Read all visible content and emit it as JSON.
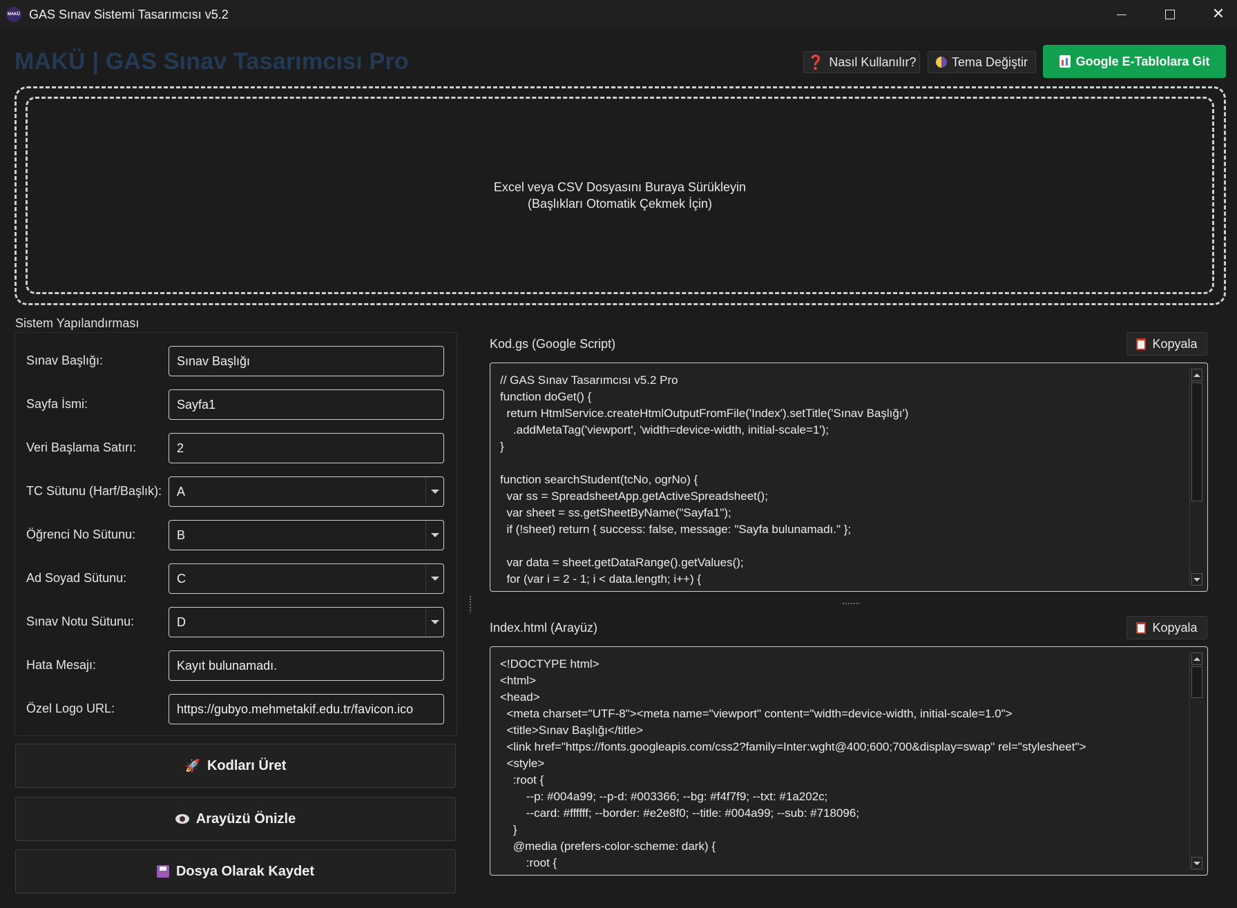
{
  "window": {
    "title": "GAS Sınav Sistemi Tasarımcısı v5.2",
    "icon_text": "MAKÜ",
    "min_icon": "minimize-icon",
    "max_icon": "maximize-icon",
    "close_icon": "close-icon",
    "close_glyph": "✕"
  },
  "header": {
    "brand": "MAKÜ | GAS Sınav Tasarımcısı Pro",
    "help_icon": "❓",
    "help_label": "Nasıl Kullanılır?",
    "theme_label": "Tema Değiştir",
    "sheets_label": "Google E-Tablolara Git",
    "sheets_color": "#12a150"
  },
  "dropzone": {
    "line1": "Excel veya CSV Dosyasını Buraya Sürükleyin",
    "line2": "(Başlıkları Otomatik Çekmek İçin)"
  },
  "config": {
    "section_title": "Sistem Yapılandırması",
    "fields": [
      {
        "label": "Sınav Başlığı:",
        "value": "Sınav Başlığı",
        "type": "text"
      },
      {
        "label": "Sayfa İsmi:",
        "value": "Sayfa1",
        "type": "text"
      },
      {
        "label": "Veri Başlama Satırı:",
        "value": "2",
        "type": "text"
      },
      {
        "label": "TC Sütunu (Harf/Başlık):",
        "value": "A",
        "type": "select"
      },
      {
        "label": "Öğrenci No Sütunu:",
        "value": "B",
        "type": "select"
      },
      {
        "label": "Ad Soyad Sütunu:",
        "value": "C",
        "type": "select"
      },
      {
        "label": "Sınav Notu Sütunu:",
        "value": "D",
        "type": "select"
      },
      {
        "label": "Hata Mesajı:",
        "value": "Kayıt bulunamadı.",
        "type": "text"
      },
      {
        "label": "Özel Logo URL:",
        "value": "https://gubyo.mehmetakif.edu.tr/favicon.ico",
        "type": "text"
      }
    ]
  },
  "actions": {
    "generate_label": "Kodları Üret",
    "generate_glyph": "🚀",
    "preview_label": "Arayüzü Önizle",
    "save_label": "Dosya Olarak Kaydet"
  },
  "code_gs": {
    "label": "Kod.gs (Google Script)",
    "copy_label": "Kopyala",
    "content": "// GAS Sınav Tasarımcısı v5.2 Pro\nfunction doGet() {\n  return HtmlService.createHtmlOutputFromFile('Index').setTitle('Sınav Başlığı')\n    .addMetaTag('viewport', 'width=device-width, initial-scale=1');\n}\n\nfunction searchStudent(tcNo, ogrNo) {\n  var ss = SpreadsheetApp.getActiveSpreadsheet();\n  var sheet = ss.getSheetByName(\"Sayfa1\");\n  if (!sheet) return { success: false, message: \"Sayfa bulunamadı.\" };\n\n  var data = sheet.getDataRange().getValues();\n  for (var i = 2 - 1; i < data.length; i++) {"
  },
  "index_html": {
    "label": "Index.html (Arayüz)",
    "copy_label": "Kopyala",
    "content": "<!DOCTYPE html>\n<html>\n<head>\n  <meta charset=\"UTF-8\"><meta name=\"viewport\" content=\"width=device-width, initial-scale=1.0\">\n  <title>Sınav Başlığı</title>\n  <link href=\"https://fonts.googleapis.com/css2?family=Inter:wght@400;600;700&display=swap\" rel=\"stylesheet\">\n  <style>\n    :root {\n        --p: #004a99; --p-d: #003366; --bg: #f4f7f9; --txt: #1a202c;\n        --card: #ffffff; --border: #e2e8f0; --title: #004a99; --sub: #718096;\n    }\n    @media (prefers-color-scheme: dark) {\n        :root {"
  }
}
